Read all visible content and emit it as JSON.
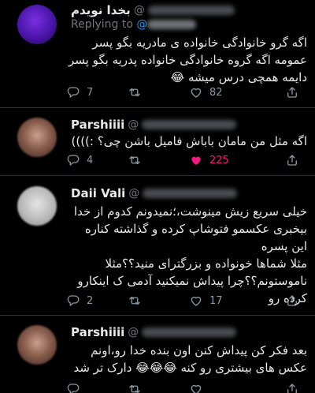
{
  "tweets": [
    {
      "name": "بخدا نویدم",
      "handle_prefix": "@",
      "replying_prefix": "Replying to ",
      "replying_at": "@",
      "text": "اگه گرو خانوادگی خانواده ی مادریه بگو پسر عمومه اگه گروه خانوادگی خانواده پدریه بگو پسر دایمه همچی درس میشه 😂",
      "replies": "7",
      "retweets": "",
      "likes": "82",
      "liked": false
    },
    {
      "name": "Parshiiii",
      "handle_prefix": "@",
      "text": "اگه مثل من مامان باباش فامیل باشن چی؟ :))))",
      "replies": "4",
      "retweets": "",
      "likes": "225",
      "liked": true
    },
    {
      "name": "Daii Vali",
      "handle_prefix": "@",
      "text": "خیلی سریع زیش مینوشت،؛نمیدونم کدوم از خدا بیخبری عکسمو فتوشاپ کرده و گذاشته کناره این پسره\nمثلا شماها خونواده و بزرگترای منید؟؟مثلا ناموستونم؟؟چرا پیداش نمیکنید آدمی ک اینکارو کرده رو",
      "replies": "2",
      "retweets": "",
      "likes": "17",
      "liked": false
    },
    {
      "name": "Parshiiii",
      "handle_prefix": "@",
      "text": "بعد فکر کن پیداش کنن اون بنده خدا رو،اونم عکس های بیشتری رو کنه 😂😂😂 دارک تر شد",
      "replies": "",
      "retweets": "",
      "likes": "",
      "liked": false
    }
  ],
  "colors": {
    "background": "#000000",
    "text": "#e7e9ea",
    "muted": "#71767b",
    "link": "#1d9bf0",
    "like": "#f91880",
    "divider": "#2f3336"
  },
  "icons": [
    "reply-icon",
    "retweet-icon",
    "heart-icon",
    "share-icon"
  ]
}
